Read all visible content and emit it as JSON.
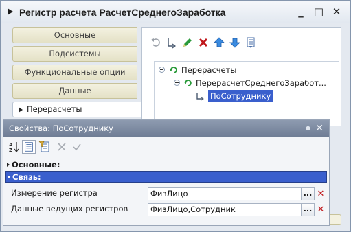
{
  "window": {
    "title": "Регистр расчета РасчетСреднегоЗаработка",
    "minimize": "_",
    "maximize": "□",
    "close": "✕"
  },
  "tabs": [
    {
      "label": "Основные"
    },
    {
      "label": "Подсистемы"
    },
    {
      "label": "Функциональные опции"
    },
    {
      "label": "Данные"
    },
    {
      "label": "Перерасчеты"
    }
  ],
  "toolbar": {
    "icons": [
      "undo-icon",
      "add-dimension-icon",
      "edit-icon",
      "delete-icon",
      "move-up-icon",
      "move-down-icon",
      "list-icon"
    ]
  },
  "tree": {
    "root": "Перерасчеты",
    "child": "ПерерасчетСреднегоЗаработ...",
    "leaf": "ПоСотруднику"
  },
  "properties": {
    "title": "Свойства: ПоСотруднику",
    "close": "✕",
    "sections": {
      "main": "Основные:",
      "link": "Связь:"
    },
    "rows": [
      {
        "label": "Измерение регистра",
        "value": "ФизЛицо",
        "dots": "...",
        "clear": "✕"
      },
      {
        "label": "Данные ведущих регистров",
        "value": "ФизЛицо,Сотрудник",
        "dots": "...",
        "clear": "✕"
      }
    ]
  },
  "colors": {
    "accent": "#3a5fcd",
    "delete": "#c0181c",
    "add": "#2a9a3a"
  }
}
